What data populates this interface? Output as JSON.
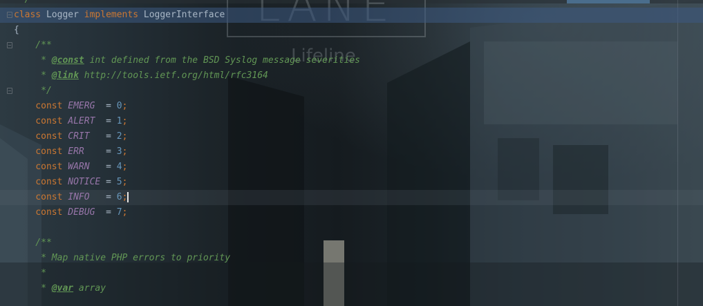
{
  "editor": {
    "watermark": {
      "lane": "LANE",
      "lifeline": "Lifeline"
    },
    "lines": [
      {
        "id": "l0",
        "segments": [
          {
            "cls": "doc",
            "t": " */"
          }
        ]
      },
      {
        "id": "l1",
        "segments": [
          {
            "cls": "kw",
            "t": "class"
          },
          {
            "cls": "plain",
            "t": " Logger "
          },
          {
            "cls": "kw",
            "t": "implements"
          },
          {
            "cls": "plain",
            "t": " LoggerInterface"
          }
        ]
      },
      {
        "id": "l2",
        "segments": [
          {
            "cls": "plain",
            "t": "{"
          }
        ]
      },
      {
        "id": "l3",
        "segments": [
          {
            "cls": "doc",
            "t": "    /**"
          }
        ]
      },
      {
        "id": "l4",
        "segments": [
          {
            "cls": "doc",
            "t": "     * "
          },
          {
            "cls": "doc-tag",
            "t": "@const"
          },
          {
            "cls": "doc",
            "t": " int defined from the BSD Syslog message severities"
          }
        ]
      },
      {
        "id": "l5",
        "segments": [
          {
            "cls": "doc",
            "t": "     * "
          },
          {
            "cls": "doc-tag",
            "t": "@link"
          },
          {
            "cls": "doc",
            "t": " http://tools.ietf.org/html/rfc3164"
          }
        ]
      },
      {
        "id": "l6",
        "segments": [
          {
            "cls": "doc",
            "t": "     */"
          }
        ]
      },
      {
        "id": "l7",
        "segments": [
          {
            "cls": "kw",
            "t": "    const "
          },
          {
            "cls": "const-name",
            "t": "EMERG"
          },
          {
            "cls": "plain",
            "t": "  = "
          },
          {
            "cls": "num",
            "t": "0"
          },
          {
            "cls": "punct",
            "t": ";"
          }
        ]
      },
      {
        "id": "l8",
        "segments": [
          {
            "cls": "kw",
            "t": "    const "
          },
          {
            "cls": "const-name",
            "t": "ALERT"
          },
          {
            "cls": "plain",
            "t": "  = "
          },
          {
            "cls": "num",
            "t": "1"
          },
          {
            "cls": "punct",
            "t": ";"
          }
        ]
      },
      {
        "id": "l9",
        "segments": [
          {
            "cls": "kw",
            "t": "    const "
          },
          {
            "cls": "const-name",
            "t": "CRIT"
          },
          {
            "cls": "plain",
            "t": "   = "
          },
          {
            "cls": "num",
            "t": "2"
          },
          {
            "cls": "punct",
            "t": ";"
          }
        ]
      },
      {
        "id": "l10",
        "segments": [
          {
            "cls": "kw",
            "t": "    const "
          },
          {
            "cls": "const-name",
            "t": "ERR"
          },
          {
            "cls": "plain",
            "t": "    = "
          },
          {
            "cls": "num",
            "t": "3"
          },
          {
            "cls": "punct",
            "t": ";"
          }
        ]
      },
      {
        "id": "l11",
        "segments": [
          {
            "cls": "kw",
            "t": "    const "
          },
          {
            "cls": "const-name",
            "t": "WARN"
          },
          {
            "cls": "plain",
            "t": "   = "
          },
          {
            "cls": "num",
            "t": "4"
          },
          {
            "cls": "punct",
            "t": ";"
          }
        ]
      },
      {
        "id": "l12",
        "segments": [
          {
            "cls": "kw",
            "t": "    const "
          },
          {
            "cls": "const-name",
            "t": "NOTICE"
          },
          {
            "cls": "plain",
            "t": " = "
          },
          {
            "cls": "num",
            "t": "5"
          },
          {
            "cls": "punct",
            "t": ";"
          }
        ]
      },
      {
        "id": "l13",
        "segments": [
          {
            "cls": "kw",
            "t": "    const "
          },
          {
            "cls": "const-name",
            "t": "INFO"
          },
          {
            "cls": "plain",
            "t": "   = "
          },
          {
            "cls": "num",
            "t": "6"
          },
          {
            "cls": "punct",
            "t": ";"
          }
        ]
      },
      {
        "id": "l14",
        "segments": [
          {
            "cls": "kw",
            "t": "    const "
          },
          {
            "cls": "const-name",
            "t": "DEBUG"
          },
          {
            "cls": "plain",
            "t": "  = "
          },
          {
            "cls": "num",
            "t": "7"
          },
          {
            "cls": "punct",
            "t": ";"
          }
        ]
      },
      {
        "id": "l15",
        "segments": [
          {
            "cls": "plain",
            "t": ""
          }
        ]
      },
      {
        "id": "l16",
        "segments": [
          {
            "cls": "doc",
            "t": "    /**"
          }
        ]
      },
      {
        "id": "l17",
        "segments": [
          {
            "cls": "doc",
            "t": "     * Map native PHP errors to priority"
          }
        ]
      },
      {
        "id": "l18",
        "segments": [
          {
            "cls": "doc",
            "t": "     *"
          }
        ]
      },
      {
        "id": "l19",
        "segments": [
          {
            "cls": "doc",
            "t": "     * "
          },
          {
            "cls": "doc-tag",
            "t": "@var"
          },
          {
            "cls": "doc",
            "t": " array"
          }
        ]
      }
    ]
  }
}
